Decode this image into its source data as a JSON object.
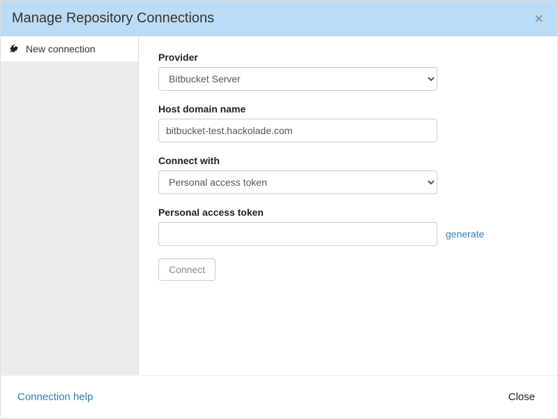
{
  "dialog": {
    "title": "Manage Repository Connections"
  },
  "sidebar": {
    "items": [
      {
        "label": "New connection"
      }
    ]
  },
  "form": {
    "provider": {
      "label": "Provider",
      "value": "Bitbucket Server"
    },
    "host": {
      "label": "Host domain name",
      "value": "bitbucket-test.hackolade.com"
    },
    "connectWith": {
      "label": "Connect with",
      "value": "Personal access token"
    },
    "token": {
      "label": "Personal access token",
      "value": "",
      "generate": "generate"
    },
    "connect": "Connect"
  },
  "footer": {
    "help": "Connection help",
    "close": "Close"
  }
}
